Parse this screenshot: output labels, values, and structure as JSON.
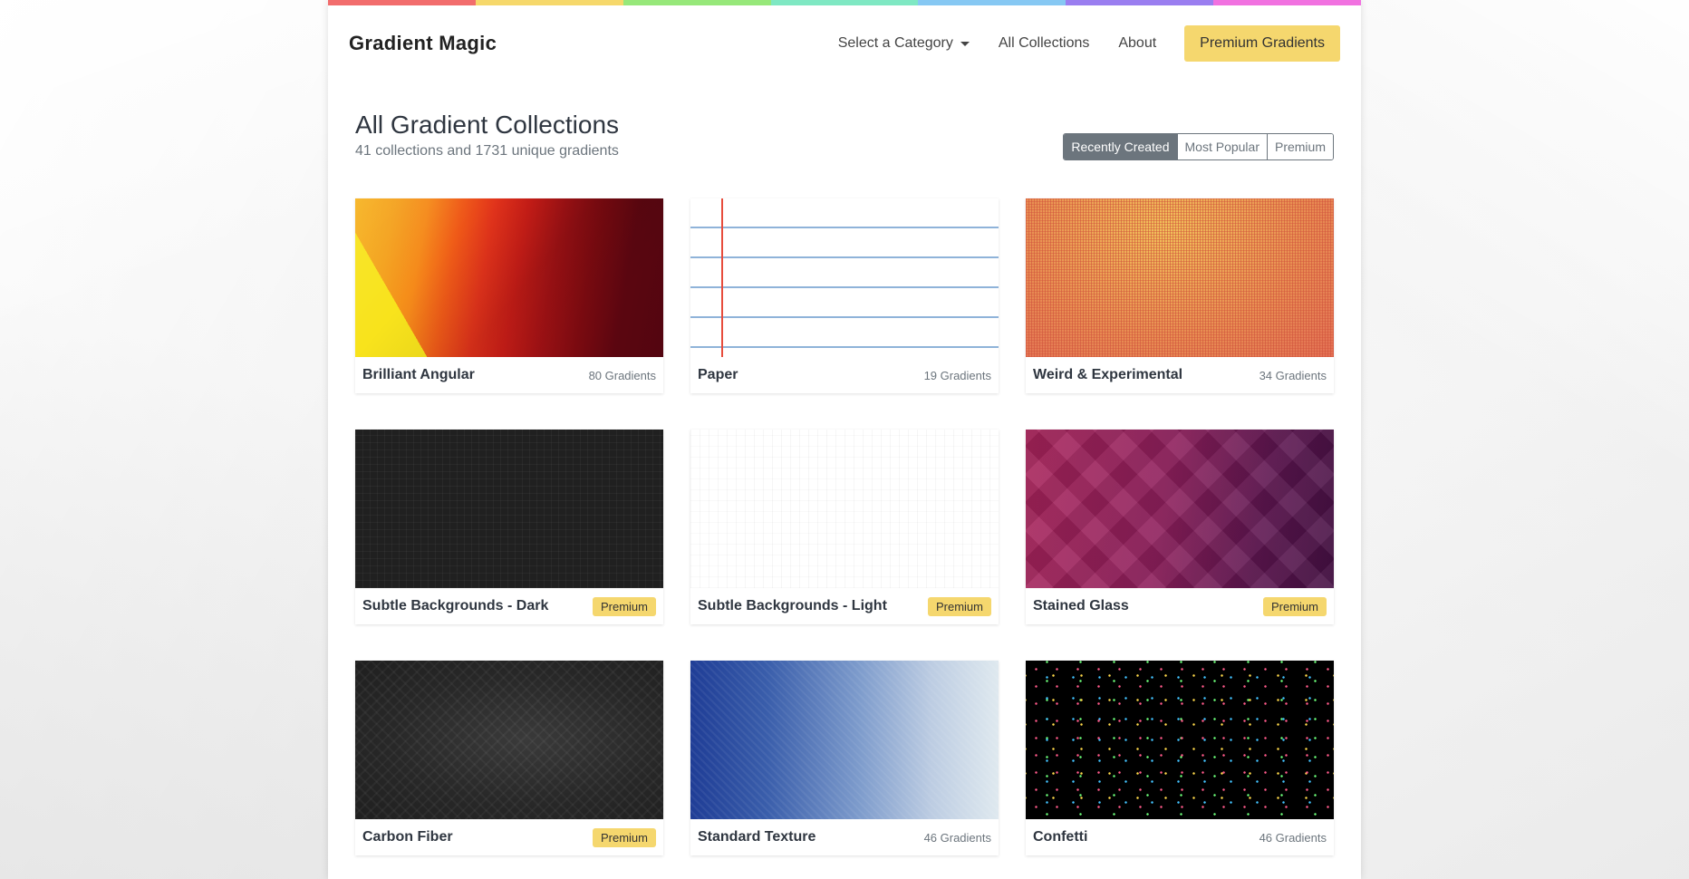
{
  "brand": "Gradient Magic",
  "rainbow_colors": [
    "#f26d6d",
    "#f6d86b",
    "#97e87a",
    "#7fe8c3",
    "#86c8f3",
    "#9a7ef0",
    "#f171e0"
  ],
  "nav": {
    "category": "Select a Category",
    "collections": "All Collections",
    "about": "About",
    "premium": "Premium Gradients"
  },
  "header": {
    "title": "All Gradient Collections",
    "subtitle": "41 collections and 1731 unique gradients"
  },
  "sort": {
    "recent": "Recently Created",
    "popular": "Most Popular",
    "premium": "Premium"
  },
  "accent_color": "#f5d76e",
  "collections": [
    {
      "name": "Brilliant Angular",
      "meta": "80 Gradients"
    },
    {
      "name": "Paper",
      "meta": "19 Gradients"
    },
    {
      "name": "Weird & Experimental",
      "meta": "34 Gradients"
    },
    {
      "name": "Subtle Backgrounds - Dark",
      "meta": "Premium"
    },
    {
      "name": "Subtle Backgrounds - Light",
      "meta": "Premium"
    },
    {
      "name": "Stained Glass",
      "meta": "Premium"
    },
    {
      "name": "Carbon Fiber",
      "meta": "Premium"
    },
    {
      "name": "Standard Texture",
      "meta": "46 Gradients"
    },
    {
      "name": "Confetti",
      "meta": "46 Gradients"
    }
  ]
}
